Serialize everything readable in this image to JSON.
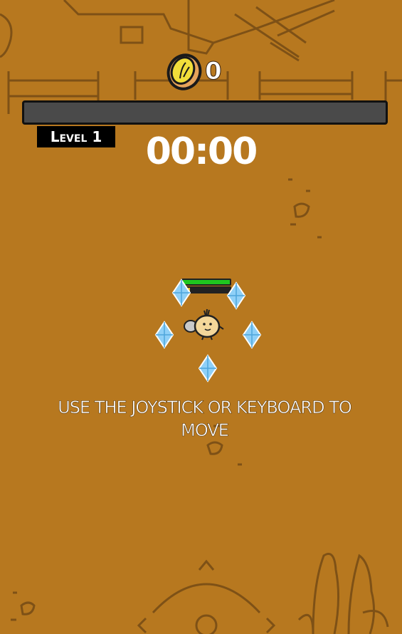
{
  "hud": {
    "coins": "0",
    "level_label": "Level 1",
    "timer": "00:00",
    "xp_progress": 0,
    "player_health": 1.0,
    "player_xp": 0.15
  },
  "hint": {
    "text": "USE THE JOYSTICK OR KEYBOARD TO MOVE"
  },
  "icons": {
    "coin": "coin-icon",
    "gem": "blue-diamond-gem",
    "player": "round-chick-character",
    "joystick": "joystick-compass-icon"
  },
  "colors": {
    "ground": "#b7781f",
    "xp_bar": "#4a4a4a",
    "health": "#1fc61f",
    "xp": "#f2c21b",
    "gem": "#7fc8f5"
  }
}
